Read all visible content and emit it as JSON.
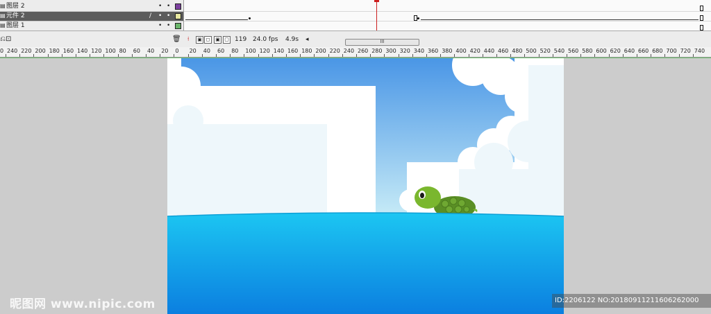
{
  "layers": [
    {
      "name": "图层 2",
      "swatch": "#7b3f9e",
      "selected": false
    },
    {
      "name": "元件 2",
      "swatch": "#e8e8a0",
      "selected": true
    },
    {
      "name": "图层 1",
      "swatch": "#6ab56a",
      "selected": false
    }
  ],
  "layer_dots": "•",
  "pencil": "/",
  "status": {
    "frame": "119",
    "fps": "24.0 fps",
    "time": "4.9s",
    "scroll_arrow": "◂",
    "scroll_grip": "III"
  },
  "ruler_labels": [
    "240",
    "220",
    "200",
    "180",
    "160",
    "140",
    "120",
    "100",
    "80",
    "60",
    "40",
    "20",
    "0",
    "20",
    "40",
    "60",
    "80",
    "100",
    "120",
    "140",
    "160",
    "180",
    "200",
    "220",
    "240",
    "260",
    "280",
    "300",
    "320",
    "340",
    "360",
    "380",
    "400",
    "420",
    "440",
    "460",
    "480",
    "500",
    "520",
    "540",
    "560",
    "580",
    "600",
    "620",
    "640",
    "660",
    "680",
    "700",
    "720",
    "740"
  ],
  "ruler_first": "0",
  "watermark": {
    "logo_text": "昵图网 www.nipic.com",
    "id_text": "ID:2206122 NO:20180911211606262000"
  },
  "colors": {
    "sky_top": "#4a96e6",
    "sky_bottom": "#c8ecf7",
    "sea_top": "#1cc6f2",
    "sea_bottom": "#0b7fe0",
    "turtle_head": "#7ab72e",
    "turtle_shell": "#5a8f25"
  }
}
